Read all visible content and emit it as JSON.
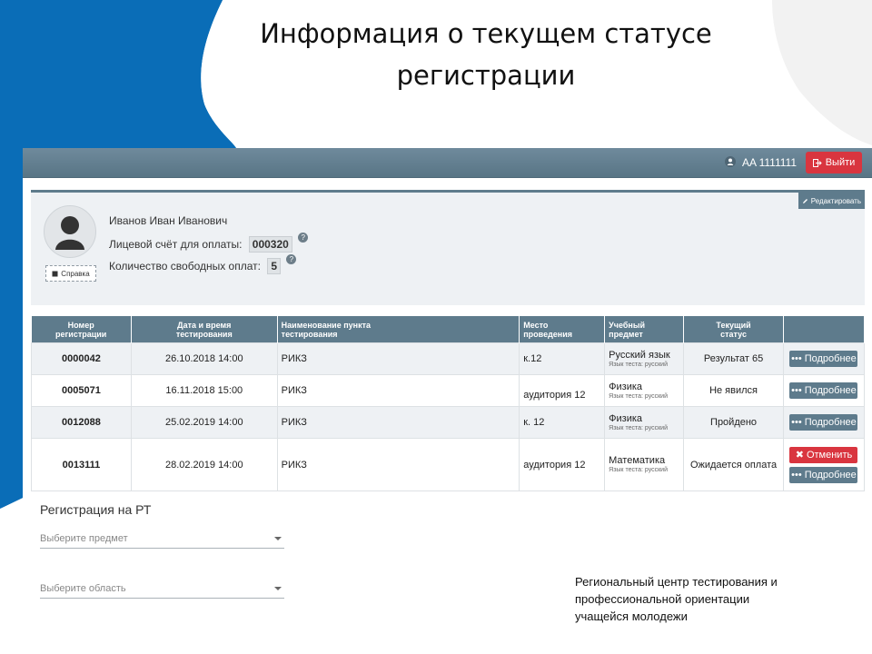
{
  "slide": {
    "title_line1": "Информация о текущем статусе",
    "title_line2": "регистрации",
    "footer": [
      "Региональный центр тестирования и",
      "профессиональной ориентации",
      "учащейся молодежи"
    ]
  },
  "topbar": {
    "user_id": "AA 1111111",
    "logout_label": "Выйти"
  },
  "profile": {
    "edit_label": "Редактировать",
    "name": "Иванов Иван Иванович",
    "account_label": "Лицевой счёт для оплаты:",
    "account_value": "000320",
    "free_label": "Количество свободных оплат:",
    "free_value": "5",
    "help_label": "Справка",
    "help_mark": "?"
  },
  "table": {
    "headers": {
      "num_1": "Номер",
      "num_2": "регистрации",
      "date_1": "Дата и время",
      "date_2": "тестирования",
      "point_1": "Наименование пункта",
      "point_2": "тестирования",
      "place_1": "Место",
      "place_2": "проведения",
      "subject_1": "Учебный",
      "subject_2": "предмет",
      "status_1": "Текущий",
      "status_2": "статус"
    },
    "rows": [
      {
        "num": "0000042",
        "date": "26.10.2018 14:00",
        "point": "РИКЗ",
        "place": "к.12",
        "subject": "Русский язык",
        "lang": "Язык теста: русский",
        "status": "Результат 65",
        "more": "Подробнее"
      },
      {
        "num": "0005071",
        "date": "16.11.2018 15:00",
        "point": "РИКЗ",
        "place": "аудитория 12",
        "subject": "Физика",
        "lang": "Язык теста: русский",
        "status": "Не явился",
        "more": "Подробнее"
      },
      {
        "num": "0012088",
        "date": "25.02.2019 14:00",
        "point": "РИКЗ",
        "place": "к. 12",
        "subject": "Физика",
        "lang": "Язык теста: русский",
        "status": "Пройдено",
        "more": "Подробнее"
      },
      {
        "num": "0013111",
        "date": "28.02.2019 14:00",
        "point": "РИКЗ",
        "place": "аудитория 12",
        "subject": "Математика",
        "lang": "Язык теста: русский",
        "status": "Ожидается оплата",
        "cancel": "Отменить",
        "more": "Подробнее"
      }
    ]
  },
  "registration": {
    "title": "Регистрация на РТ",
    "subject_placeholder": "Выберите предмет",
    "region_placeholder": "Выберите область"
  },
  "colors": {
    "brand_blue": "#0a6db7",
    "header_slate": "#5e7b8c",
    "danger": "#d9353f"
  }
}
